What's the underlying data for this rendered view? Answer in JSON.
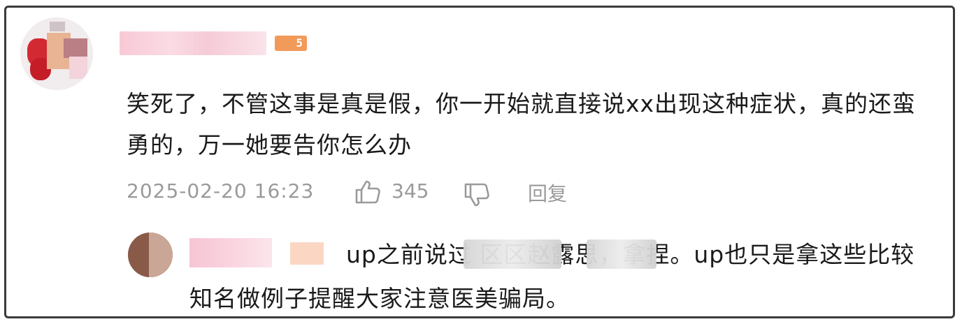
{
  "comment": {
    "text": "笑死了，不管这事是真是假，你一开始就直接说xx出现这种症状，真的还蛮勇的，万一她要告你怎么办",
    "timestamp": "2025-02-20 16:23",
    "like_count": "345",
    "reply_label": "回复",
    "level_badge": "5"
  },
  "reply": {
    "text": "up之前说过                    区区赵露思，拿捏。up也只是拿这些比较知名做例子提醒大家注意医美骗局。"
  },
  "icons": {
    "like": "thumbs-up-icon",
    "dislike": "thumbs-down-icon"
  },
  "colors": {
    "text": "#1a1a1a",
    "meta": "#9a9a9a",
    "badge": "#f19a5a"
  }
}
